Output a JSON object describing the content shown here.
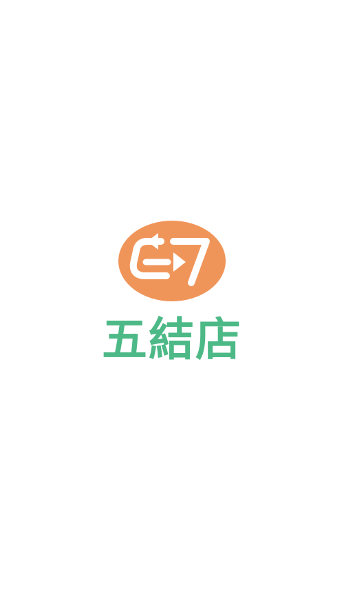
{
  "app": {
    "name": "五結店"
  },
  "logo": {
    "icon": "exchange-arrows-logo",
    "colors": {
      "emblem": "#f0955a",
      "glyph": "#ffffff"
    }
  },
  "brand": {
    "color": "#4cb987"
  },
  "background": "#ffffff"
}
